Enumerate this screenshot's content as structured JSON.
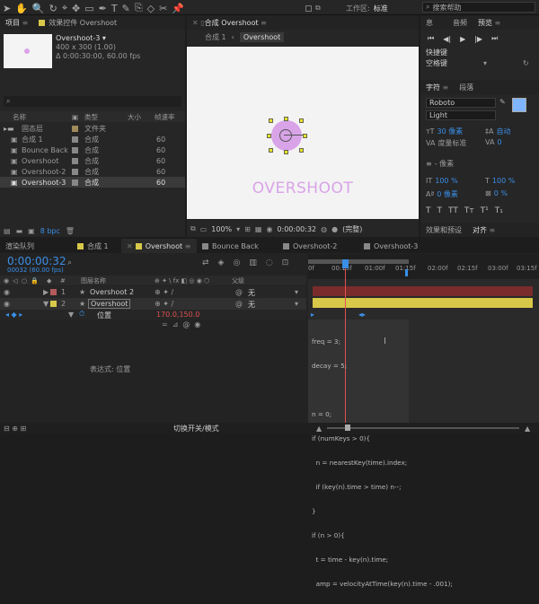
{
  "colors": {
    "accent": "#3a8ee6",
    "circle": "#d9a3e8",
    "handle": "#e8e32b",
    "track_red": "#7a2c2c",
    "track_yellow": "#d8c84a",
    "fill_swatch": "#7fb5ff"
  },
  "toolbar": {
    "workspace_label": "工作区:",
    "workspace_value": "标准",
    "search_placeholder": "搜索帮助"
  },
  "project": {
    "tab": "项目",
    "effects_tab": "效果控件 Overshoot",
    "comp_name": "Overshoot-3 ▾",
    "comp_size": "400 x 300 (1.00)",
    "comp_duration": "Δ 0:00:30:00, 60.00 fps",
    "search_placeholder": "",
    "cols": [
      "名称",
      "类型",
      "大小",
      "帧速率"
    ],
    "items": [
      {
        "name": "固态层",
        "type": "文件夹",
        "fps": "",
        "sel": false
      },
      {
        "name": "合成 1",
        "type": "合成",
        "fps": "60",
        "sel": false
      },
      {
        "name": "Bounce Back",
        "type": "合成",
        "fps": "60",
        "sel": false
      },
      {
        "name": "Overshoot",
        "type": "合成",
        "fps": "60",
        "sel": false
      },
      {
        "name": "Overshoot-2",
        "type": "合成",
        "fps": "60",
        "sel": false
      },
      {
        "name": "Overshoot-3",
        "type": "合成",
        "fps": "60",
        "sel": true
      }
    ],
    "bpc": "8 bpc"
  },
  "composition": {
    "tab": "合成 Overshoot",
    "bc_comp": "合成 1",
    "bc_current": "Overshoot",
    "text": "OVERSHOOT",
    "zoom": "100%",
    "timecode": "0:00:00:32",
    "quality": "(完整)"
  },
  "right": {
    "tabs_top": [
      "息",
      "音频",
      "预览"
    ],
    "shortcut_label": "快捷键",
    "shortcut_value": "空格键",
    "char_tabs": [
      "字符",
      "段落"
    ],
    "font": "Roboto",
    "style": "Light",
    "size": "30 像素",
    "auto": "自动",
    "tracking_label": "度量标准",
    "tracking_val": "0",
    "line_px": "- 像素",
    "vscale": "100 %",
    "hscale": "100 %",
    "baseline": "0 像素",
    "tsume": "0 %",
    "effects_tab": "效果和预设",
    "align_tab": "对齐"
  },
  "timeline": {
    "tabs": [
      "渲染队列",
      "合成 1",
      "Overshoot",
      "Bounce Back",
      "Overshoot-2",
      "Overshoot-3"
    ],
    "active_tab": 2,
    "timecode": "0:00:00:32",
    "frame_info": "00032 (60.00 fps)",
    "col_layer": "图层名称",
    "col_parent": "父级",
    "ruler": [
      "0f",
      "00:15f",
      "01:00f",
      "01:15f",
      "02:00f",
      "02:15f",
      "03:00f",
      "03:15f"
    ],
    "layers": [
      {
        "num": "1",
        "name": "Overshoot 2",
        "parent": "无",
        "color": "#b55a5a"
      },
      {
        "num": "2",
        "name": "Overshoot",
        "parent": "无",
        "color": "#d8c84a"
      }
    ],
    "prop_name": "位置",
    "prop_value": "170.0,150.0",
    "expr_label": "表达式: 位置",
    "expression": [
      "freq = 3;",
      "decay = 5;",
      "",
      "n = 0;",
      "if (numKeys > 0){",
      "  n = nearestKey(time).index;",
      "  if (key(n).time > time) n--;",
      "}",
      "if (n > 0){",
      "  t = time - key(n).time;",
      "  amp = velocityAtTime(key(n).time - .001);"
    ],
    "bottom_label": "切换开关/模式"
  }
}
